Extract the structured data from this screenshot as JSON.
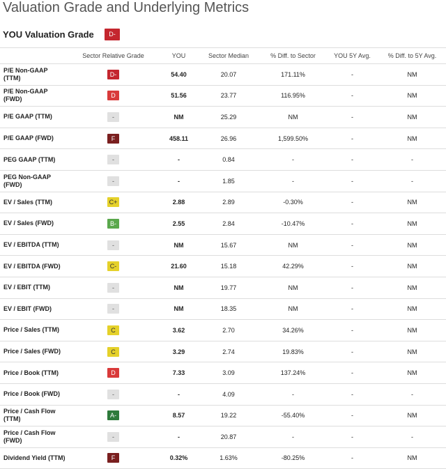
{
  "title": "Valuation Grade and Underlying Metrics",
  "grade_header": {
    "label": "YOU Valuation Grade",
    "grade": "D-",
    "grade_color": "#c4262e"
  },
  "columns": [
    "",
    "Sector Relative Grade",
    "YOU",
    "Sector Median",
    "% Diff. to Sector",
    "YOU 5Y Avg.",
    "% Diff. to 5Y Avg."
  ],
  "rows": [
    {
      "metric": "P/E Non-GAAP (TTM)",
      "grade": "D-",
      "gcls": "g-Dm",
      "you": "54.40",
      "median": "20.07",
      "diff": "171.11%",
      "avg5": "-",
      "diff5": "NM"
    },
    {
      "metric": "P/E Non-GAAP (FWD)",
      "grade": "D",
      "gcls": "g-D",
      "you": "51.56",
      "median": "23.77",
      "diff": "116.95%",
      "avg5": "-",
      "diff5": "NM"
    },
    {
      "metric": "P/E GAAP (TTM)",
      "grade": "-",
      "gcls": "g-na",
      "you": "NM",
      "median": "25.29",
      "diff": "NM",
      "avg5": "-",
      "diff5": "NM"
    },
    {
      "metric": "P/E GAAP (FWD)",
      "grade": "F",
      "gcls": "g-F",
      "you": "458.11",
      "median": "26.96",
      "diff": "1,599.50%",
      "avg5": "-",
      "diff5": "NM"
    },
    {
      "metric": "PEG GAAP (TTM)",
      "grade": "-",
      "gcls": "g-na",
      "you": "-",
      "median": "0.84",
      "diff": "-",
      "avg5": "-",
      "diff5": "-"
    },
    {
      "metric": "PEG Non-GAAP (FWD)",
      "grade": "-",
      "gcls": "g-na",
      "you": "-",
      "median": "1.85",
      "diff": "-",
      "avg5": "-",
      "diff5": "-"
    },
    {
      "metric": "EV / Sales (TTM)",
      "grade": "C+",
      "gcls": "g-Cp",
      "you": "2.88",
      "median": "2.89",
      "diff": "-0.30%",
      "avg5": "-",
      "diff5": "NM"
    },
    {
      "metric": "EV / Sales (FWD)",
      "grade": "B-",
      "gcls": "g-Bm",
      "you": "2.55",
      "median": "2.84",
      "diff": "-10.47%",
      "avg5": "-",
      "diff5": "NM"
    },
    {
      "metric": "EV / EBITDA (TTM)",
      "grade": "-",
      "gcls": "g-na",
      "you": "NM",
      "median": "15.67",
      "diff": "NM",
      "avg5": "-",
      "diff5": "NM"
    },
    {
      "metric": "EV / EBITDA (FWD)",
      "grade": "C-",
      "gcls": "g-Cm",
      "you": "21.60",
      "median": "15.18",
      "diff": "42.29%",
      "avg5": "-",
      "diff5": "NM"
    },
    {
      "metric": "EV / EBIT (TTM)",
      "grade": "-",
      "gcls": "g-na",
      "you": "NM",
      "median": "19.77",
      "diff": "NM",
      "avg5": "-",
      "diff5": "NM"
    },
    {
      "metric": "EV / EBIT (FWD)",
      "grade": "-",
      "gcls": "g-na",
      "you": "NM",
      "median": "18.35",
      "diff": "NM",
      "avg5": "-",
      "diff5": "NM"
    },
    {
      "metric": "Price / Sales (TTM)",
      "grade": "C",
      "gcls": "g-C",
      "you": "3.62",
      "median": "2.70",
      "diff": "34.26%",
      "avg5": "-",
      "diff5": "NM"
    },
    {
      "metric": "Price / Sales (FWD)",
      "grade": "C",
      "gcls": "g-C",
      "you": "3.29",
      "median": "2.74",
      "diff": "19.83%",
      "avg5": "-",
      "diff5": "NM"
    },
    {
      "metric": "Price / Book (TTM)",
      "grade": "D",
      "gcls": "g-D",
      "you": "7.33",
      "median": "3.09",
      "diff": "137.24%",
      "avg5": "-",
      "diff5": "NM"
    },
    {
      "metric": "Price / Book (FWD)",
      "grade": "-",
      "gcls": "g-na",
      "you": "-",
      "median": "4.09",
      "diff": "-",
      "avg5": "-",
      "diff5": "-"
    },
    {
      "metric": "Price / Cash Flow (TTM)",
      "grade": "A-",
      "gcls": "g-Am",
      "you": "8.57",
      "median": "19.22",
      "diff": "-55.40%",
      "avg5": "-",
      "diff5": "NM"
    },
    {
      "metric": "Price / Cash Flow (FWD)",
      "grade": "-",
      "gcls": "g-na",
      "you": "-",
      "median": "20.87",
      "diff": "-",
      "avg5": "-",
      "diff5": "-"
    },
    {
      "metric": "Dividend Yield (TTM)",
      "grade": "F",
      "gcls": "g-F",
      "you": "0.32%",
      "median": "1.63%",
      "diff": "-80.25%",
      "avg5": "-",
      "diff5": "NM"
    }
  ]
}
